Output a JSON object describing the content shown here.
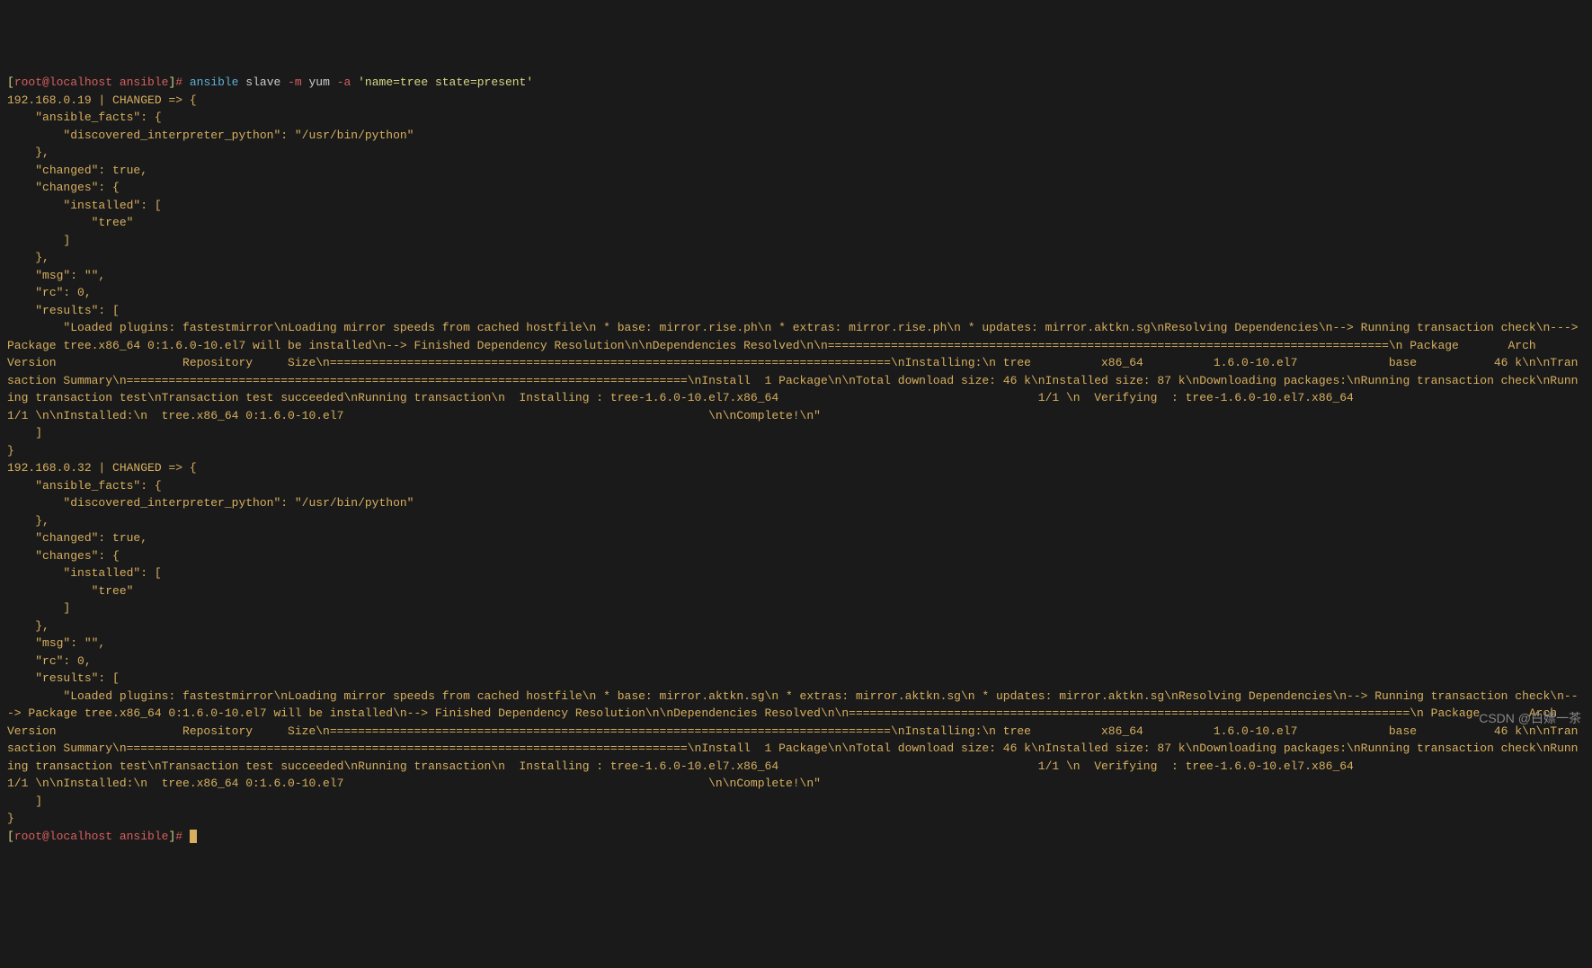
{
  "prompt1": {
    "bracket_open": "[",
    "user_host": "root@localhost ansible",
    "bracket_close": "]",
    "hash": "# ",
    "cmd": "ansible",
    "target": " slave ",
    "flag_m": "-m",
    "mod": " yum ",
    "flag_a": "-a",
    "args": " 'name=tree state=present'"
  },
  "host1": {
    "header": "192.168.0.19 | CHANGED => {",
    "facts_open": "    \"ansible_facts\": {",
    "interp": "        \"discovered_interpreter_python\": \"/usr/bin/python\"",
    "facts_close": "    },",
    "changed": "    \"changed\": true,",
    "changes_open": "    \"changes\": {",
    "installed_open": "        \"installed\": [",
    "tree": "            \"tree\"",
    "installed_close": "        ]",
    "changes_close": "    },",
    "msg": "    \"msg\": \"\",",
    "rc": "    \"rc\": 0,",
    "results_open": "    \"results\": [",
    "results_text": "        \"Loaded plugins: fastestmirror\\nLoading mirror speeds from cached hostfile\\n * base: mirror.rise.ph\\n * extras: mirror.rise.ph\\n * updates: mirror.aktkn.sg\\nResolving Dependencies\\n--> Running transaction check\\n---> Package tree.x86_64 0:1.6.0-10.el7 will be installed\\n--> Finished Dependency Resolution\\n\\nDependencies Resolved\\n\\n================================================================================\\n Package       Arch            Version                  Repository     Size\\n================================================================================\\nInstalling:\\n tree          x86_64          1.6.0-10.el7             base           46 k\\n\\nTransaction Summary\\n================================================================================\\nInstall  1 Package\\n\\nTotal download size: 46 k\\nInstalled size: 87 k\\nDownloading packages:\\nRunning transaction check\\nRunning transaction test\\nTransaction test succeeded\\nRunning transaction\\n  Installing : tree-1.6.0-10.el7.x86_64                                     1/1 \\n  Verifying  : tree-1.6.0-10.el7.x86_64                                     1/1 \\n\\nInstalled:\\n  tree.x86_64 0:1.6.0-10.el7                                                    \\n\\nComplete!\\n\"",
    "results_close": "    ]",
    "close": "}"
  },
  "host2": {
    "header": "192.168.0.32 | CHANGED => {",
    "facts_open": "    \"ansible_facts\": {",
    "interp": "        \"discovered_interpreter_python\": \"/usr/bin/python\"",
    "facts_close": "    },",
    "changed": "    \"changed\": true,",
    "changes_open": "    \"changes\": {",
    "installed_open": "        \"installed\": [",
    "tree": "            \"tree\"",
    "installed_close": "        ]",
    "changes_close": "    },",
    "msg": "    \"msg\": \"\",",
    "rc": "    \"rc\": 0,",
    "results_open": "    \"results\": [",
    "results_text": "        \"Loaded plugins: fastestmirror\\nLoading mirror speeds from cached hostfile\\n * base: mirror.aktkn.sg\\n * extras: mirror.aktkn.sg\\n * updates: mirror.aktkn.sg\\nResolving Dependencies\\n--> Running transaction check\\n---> Package tree.x86_64 0:1.6.0-10.el7 will be installed\\n--> Finished Dependency Resolution\\n\\nDependencies Resolved\\n\\n================================================================================\\n Package       Arch            Version                  Repository     Size\\n================================================================================\\nInstalling:\\n tree          x86_64          1.6.0-10.el7             base           46 k\\n\\nTransaction Summary\\n================================================================================\\nInstall  1 Package\\n\\nTotal download size: 46 k\\nInstalled size: 87 k\\nDownloading packages:\\nRunning transaction check\\nRunning transaction test\\nTransaction test succeeded\\nRunning transaction\\n  Installing : tree-1.6.0-10.el7.x86_64                                     1/1 \\n  Verifying  : tree-1.6.0-10.el7.x86_64                                     1/1 \\n\\nInstalled:\\n  tree.x86_64 0:1.6.0-10.el7                                                    \\n\\nComplete!\\n\"",
    "results_close": "    ]",
    "close": "}"
  },
  "prompt2": {
    "bracket_open": "[",
    "user_host": "root@localhost ansible",
    "bracket_close": "]",
    "hash": "# "
  },
  "watermark": "CSDN @白嫖一茶"
}
